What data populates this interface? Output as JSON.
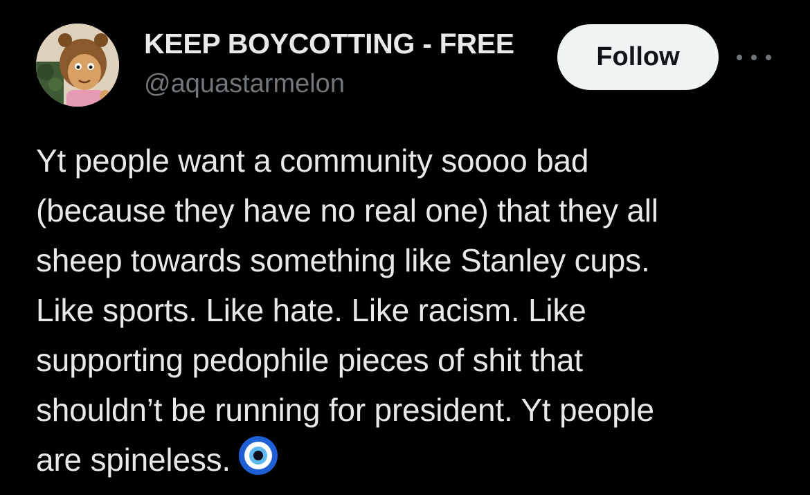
{
  "author": {
    "display_name": "KEEP BOYCOTTING - FREE",
    "handle": "@aquastarmelon",
    "avatar_icon": "cartoon-character-avatar"
  },
  "actions": {
    "follow_label": "Follow",
    "more_icon": "more-horizontal-icon"
  },
  "post": {
    "text": "Yt people want a community soooo bad\n(because they have no real one) that they all\nsheep towards something like Stanley cups.\nLike sports. Like hate. Like racism. Like\nsupporting pedophile pieces of shit that\nshouldn’t be running for president. Yt people\nare spineless.",
    "emoji": "nazar-amulet-icon"
  },
  "colors": {
    "background": "#000000",
    "text_primary": "#e7e9ea",
    "text_secondary": "#71767b",
    "button_bg": "#eff3f4",
    "button_text": "#0f1419",
    "emoji_blue": "#1f5fd6"
  }
}
